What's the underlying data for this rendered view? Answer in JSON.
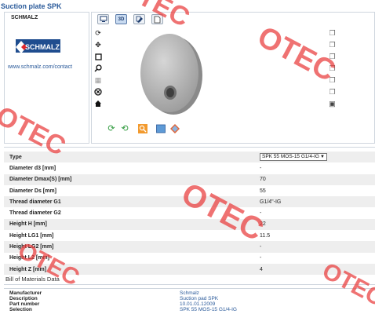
{
  "page": {
    "title": "Suction plate SPK"
  },
  "brand": {
    "name": "SCHMALZ",
    "logo_text": "SCHMALZ",
    "link": "www.schmalz.com/contact"
  },
  "viewer": {
    "tabs": [
      {
        "icon": "monitor-icon",
        "label": ""
      },
      {
        "icon": "3d-icon",
        "label": "3D"
      },
      {
        "icon": "edit-icon",
        "label": ""
      },
      {
        "icon": "page-icon",
        "label": ""
      }
    ],
    "toolbar_icons": [
      "rotate-icon",
      "pan-icon",
      "zoom-box-icon",
      "zoom-icon",
      "measure-icon",
      "section-icon",
      "home-icon"
    ],
    "side_icons": [
      "view-cube-front-icon",
      "view-cube-top-icon",
      "view-cube-left-icon",
      "view-cube-right-icon",
      "view-cube-bottom-icon",
      "view-cube-back-icon",
      "view-cube-iso-icon"
    ],
    "bottom_icons": [
      "refresh-icon",
      "refresh-all-icon",
      "search-icon",
      "display-icon",
      "diamond-icon"
    ]
  },
  "properties": {
    "type_label": "Type",
    "type_value": "SPK 55 MOS-15 G1/4-IG",
    "rows": [
      {
        "label": "Diameter d3 [mm]",
        "value": "-"
      },
      {
        "label": "Diameter Dmax(S) [mm]",
        "value": "70"
      },
      {
        "label": "Diameter Ds [mm]",
        "value": "55"
      },
      {
        "label": "Thread diameter G1",
        "value": "G1/4\"-IG"
      },
      {
        "label": "Thread diameter G2",
        "value": "-"
      },
      {
        "label": "Height H [mm]",
        "value": "22"
      },
      {
        "label": "Height LG1 [mm]",
        "value": "11.5"
      },
      {
        "label": "Height LG2 [mm]",
        "value": "-"
      },
      {
        "label": "Height L2 [mm]",
        "value": "-"
      },
      {
        "label": "Height Z [mm]",
        "value": "4"
      }
    ]
  },
  "bom": {
    "title": "Bill of Materials Data",
    "rows": [
      {
        "label": "Manufacturer",
        "value": "Schmalz"
      },
      {
        "label": "Description",
        "value": "Suction pad SPK"
      },
      {
        "label": "Part number",
        "value": "10.01.01.12009"
      },
      {
        "label": "Selection",
        "value": "SPK 55 MOS-15 G1/4-IG"
      }
    ]
  },
  "watermark": {
    "text": "OTEC",
    "color": "#e93c3c"
  },
  "colors": {
    "accent": "#2a5a9a",
    "panel_border": "#cfd6de",
    "row_shade": "#eeeeee"
  }
}
